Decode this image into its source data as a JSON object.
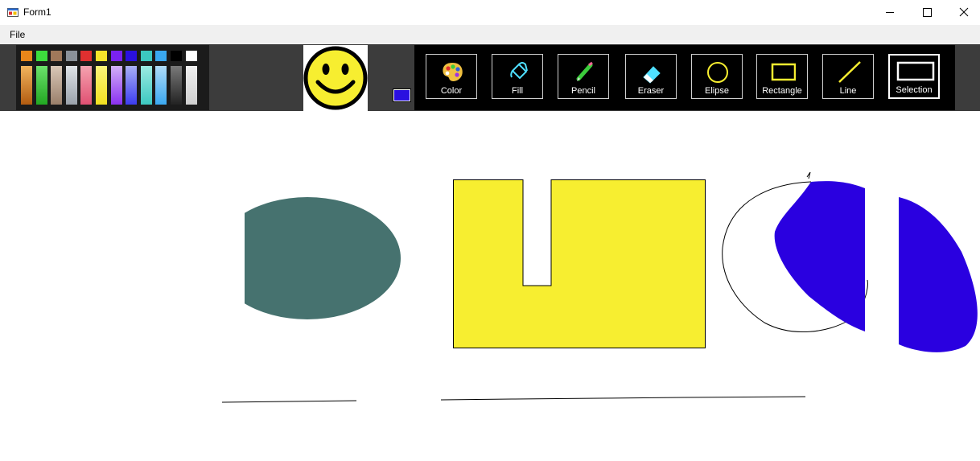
{
  "window": {
    "title": "Form1",
    "controls": [
      "minimize",
      "maximize",
      "close"
    ]
  },
  "menu": {
    "items": [
      "File"
    ]
  },
  "palette": {
    "colors": [
      {
        "top": "#e8861a",
        "light": "#f2b55e",
        "dark": "#b25b10"
      },
      {
        "top": "#3ddd3d",
        "light": "#6ce26c",
        "dark": "#22a822"
      },
      {
        "top": "#a0785a",
        "light": "#d9c8b8",
        "dark": "#9a7f6a"
      },
      {
        "top": "#8a9199",
        "light": "#dfe3e8",
        "dark": "#9aa2ab"
      },
      {
        "top": "#e03030",
        "light": "#f5a3b0",
        "dark": "#e05072"
      },
      {
        "top": "#f5e52a",
        "light": "#fbf47a",
        "dark": "#f2e020"
      },
      {
        "top": "#7a22f0",
        "light": "#d2b0f8",
        "dark": "#8a30f0"
      },
      {
        "top": "#2a10e0",
        "light": "#a9b0f5",
        "dark": "#3c3cf0"
      },
      {
        "top": "#3cc8c0",
        "light": "#9cebe2",
        "dark": "#3cc8c0"
      },
      {
        "top": "#3aa8f0",
        "light": "#b0dcf8",
        "dark": "#3aa8f0"
      },
      {
        "top": "#000000",
        "light": "#7a7a7a",
        "dark": "#222222"
      },
      {
        "top": "#ffffff",
        "light": "#f0f0f0",
        "dark": "#cfcfcf"
      }
    ]
  },
  "current_color": "#2a10e0",
  "tools": [
    {
      "label": "Color",
      "icon": "palette-icon",
      "selected": false
    },
    {
      "label": "Fill",
      "icon": "paint-bucket-icon",
      "selected": false
    },
    {
      "label": "Pencil",
      "icon": "pencil-icon",
      "selected": false
    },
    {
      "label": "Eraser",
      "icon": "eraser-icon",
      "selected": false
    },
    {
      "label": "Elipse",
      "icon": "ellipse-icon",
      "selected": false
    },
    {
      "label": "Rectangle",
      "icon": "rectangle-icon",
      "selected": false
    },
    {
      "label": "Line",
      "icon": "line-icon",
      "selected": false
    },
    {
      "label": "Selection",
      "icon": "selection-icon",
      "selected": true
    }
  ],
  "drawing": {
    "teal_ellipse_color": "#46726f",
    "yellow_rect_color": "#f7ee30",
    "blue_shape_color": "#2a00e0",
    "stroke_color": "#000000"
  }
}
